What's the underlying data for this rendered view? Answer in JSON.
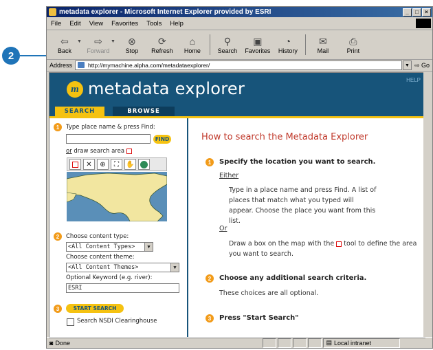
{
  "callout": {
    "number": "2"
  },
  "window": {
    "title": "metadata explorer - Microsoft Internet Explorer provided by ESRI"
  },
  "menu": [
    "File",
    "Edit",
    "View",
    "Favorites",
    "Tools",
    "Help"
  ],
  "toolbar": {
    "back": "Back",
    "forward": "Forward",
    "stop": "Stop",
    "refresh": "Refresh",
    "home": "Home",
    "search": "Search",
    "favorites": "Favorites",
    "history": "History",
    "mail": "Mail",
    "print": "Print"
  },
  "address": {
    "label": "Address",
    "url": "http://mymachine.alpha.com/metadataexplorer/",
    "go": "Go"
  },
  "site": {
    "logo_letter": "m",
    "title": "metadata explorer",
    "help": "HELP"
  },
  "tabs": {
    "search": "SEARCH",
    "browse": "BROWSE"
  },
  "left": {
    "step1_num": "1",
    "step1_label": "Type place name & press Find:",
    "find": "FIND",
    "or": "or",
    "draw_area": " draw search area",
    "step2_num": "2",
    "content_type_label": "Choose content type:",
    "content_type_value": "<All Content Types>",
    "content_theme_label": "Choose content theme:",
    "content_theme_value": "<All Content Themes>",
    "keyword_label": "Optional Keyword (e.g. river):",
    "keyword_value": "ESRI",
    "step3_num": "3",
    "start_search": "START SEARCH",
    "nsdi": "Search NSDI Clearinghouse"
  },
  "right": {
    "title": "How to search the Metadata Explorer",
    "s1_num": "1",
    "s1_heading": "Specify the location you want to search.",
    "either": "Either",
    "p1": "Type in a place name and press Find. A list of places that match what you typed will appear. Choose the place you want from this list.",
    "or": "Or",
    "p2a": "Draw a box on the map with the",
    "p2b": "tool to define the area you want to search.",
    "s2_num": "2",
    "s2_heading": "Choose any additional search criteria.",
    "p3": "These choices are all optional.",
    "s3_num": "3",
    "s3_heading": "Press \"Start Search\""
  },
  "status": {
    "done": "Done",
    "zone": "Local intranet"
  }
}
